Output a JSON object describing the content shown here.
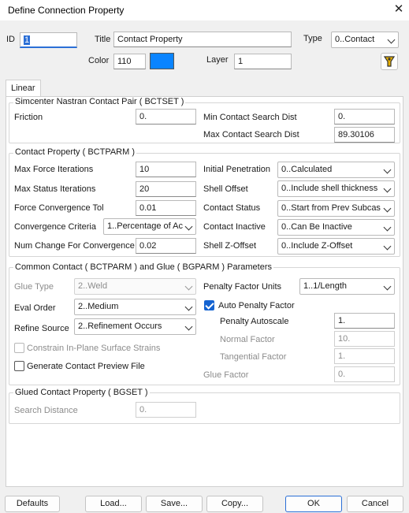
{
  "window": {
    "title": "Define Connection Property",
    "close_glyph": "✕"
  },
  "header": {
    "id_label": "ID",
    "id_value": "1",
    "title_label": "Title",
    "title_value": "Contact Property",
    "type_label": "Type",
    "type_value": "0..Contact",
    "color_label": "Color",
    "color_value": "110",
    "color_swatch": "#0a84ff",
    "layer_label": "Layer",
    "layer_value": "1"
  },
  "tabs": [
    {
      "label": "Linear"
    }
  ],
  "bctset": {
    "title": "Simcenter Nastran Contact Pair ( BCTSET )",
    "friction_label": "Friction",
    "friction_value": "0.",
    "min_search_label": "Min Contact Search Dist",
    "min_search_value": "0.",
    "max_search_label": "Max Contact Search Dist",
    "max_search_value": "89.30106"
  },
  "bctparm": {
    "title": "Contact Property ( BCTPARM )",
    "max_force_label": "Max Force Iterations",
    "max_force_value": "10",
    "max_status_label": "Max Status Iterations",
    "max_status_value": "20",
    "force_tol_label": "Force Convergence Tol",
    "force_tol_value": "0.01",
    "conv_crit_label": "Convergence Criteria",
    "conv_crit_value": "1..Percentage of Ac",
    "num_change_label": "Num Change For Convergence",
    "num_change_value": "0.02",
    "init_pen_label": "Initial Penetration",
    "init_pen_value": "0..Calculated",
    "shell_offset_label": "Shell Offset",
    "shell_offset_value": "0..Include shell thickness",
    "contact_status_label": "Contact Status",
    "contact_status_value": "0..Start from Prev Subcas",
    "contact_inactive_label": "Contact Inactive",
    "contact_inactive_value": "0..Can Be Inactive",
    "shell_z_label": "Shell Z-Offset",
    "shell_z_value": "0..Include Z-Offset"
  },
  "common": {
    "title": "Common Contact ( BCTPARM ) and Glue ( BGPARM ) Parameters",
    "glue_type_label": "Glue Type",
    "glue_type_value": "2..Weld",
    "eval_order_label": "Eval Order",
    "eval_order_value": "2..Medium",
    "refine_source_label": "Refine Source",
    "refine_source_value": "2..Refinement Occurs",
    "constrain_label": "Constrain In-Plane Surface Strains",
    "preview_label": "Generate Contact Preview File",
    "penalty_units_label": "Penalty Factor Units",
    "penalty_units_value": "1..1/Length",
    "auto_penalty_label": "Auto Penalty Factor",
    "penalty_autoscale_label": "Penalty Autoscale",
    "penalty_autoscale_value": "1.",
    "normal_factor_label": "Normal Factor",
    "normal_factor_value": "10.",
    "tangential_factor_label": "Tangential Factor",
    "tangential_factor_value": "1.",
    "glue_factor_label": "Glue Factor",
    "glue_factor_value": "0."
  },
  "bgset": {
    "title": "Glued Contact Property ( BGSET )",
    "search_distance_label": "Search Distance",
    "search_distance_value": "0."
  },
  "footer": {
    "defaults": "Defaults",
    "load": "Load...",
    "save": "Save...",
    "copy": "Copy...",
    "ok": "OK",
    "cancel": "Cancel"
  }
}
